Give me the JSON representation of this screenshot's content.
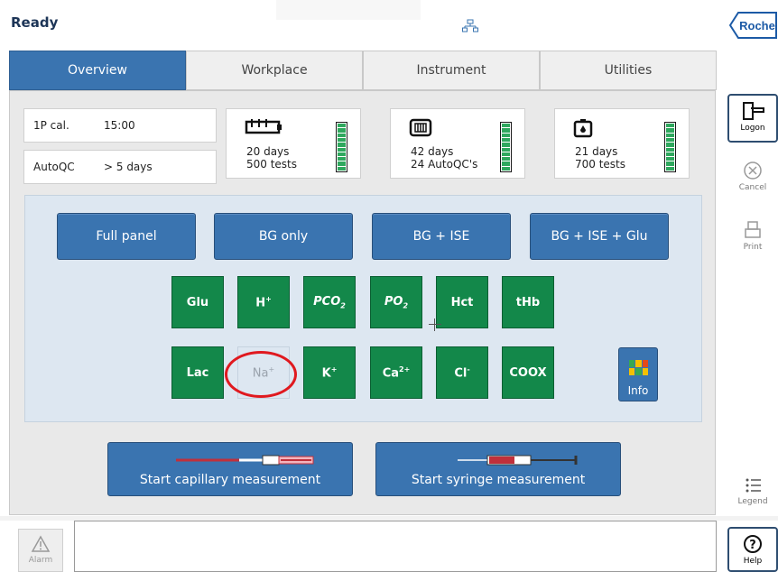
{
  "header": {
    "status": "Ready",
    "brand": "Roche"
  },
  "tabs": [
    {
      "label": "Overview",
      "active": true
    },
    {
      "label": "Workplace",
      "active": false
    },
    {
      "label": "Instrument",
      "active": false
    },
    {
      "label": "Utilities",
      "active": false
    }
  ],
  "calibration": {
    "cal_label": "1P cal.",
    "cal_value": "15:00",
    "qc_label": "AutoQC",
    "qc_value": "> 5 days"
  },
  "consumables": [
    {
      "icon": "sensor-cartridge-icon",
      "line1": "20 days",
      "line2": "500 tests",
      "level": 1.0
    },
    {
      "icon": "qc-cartridge-icon",
      "line1": "42 days",
      "line2": "24 AutoQC's",
      "level": 1.0
    },
    {
      "icon": "solution-pack-icon",
      "line1": "21 days",
      "line2": "700 tests",
      "level": 1.0
    }
  ],
  "panels": [
    "Full panel",
    "BG only",
    "BG + ISE",
    "BG + ISE + Glu"
  ],
  "parameters": {
    "glu": "Glu",
    "h_base": "H",
    "h_sup": "+",
    "pco2_base": "PCO",
    "pco2_sub": "2",
    "po2_base": "PO",
    "po2_sub": "2",
    "hct": "Hct",
    "thb": "tHb",
    "lac": "Lac",
    "na_base": "Na",
    "na_sup": "+",
    "k_base": "K",
    "k_sup": "+",
    "ca_base": "Ca",
    "ca_sup": "2+",
    "cl_base": "Cl",
    "cl_sup": "-",
    "coox": "COOX"
  },
  "info_label": "Info",
  "measurement": {
    "capillary": "Start capillary measurement",
    "syringe": "Start syringe measurement"
  },
  "sidebar": {
    "logon": "Logon",
    "cancel": "Cancel",
    "print": "Print",
    "legend": "Legend",
    "help": "Help"
  },
  "footer": {
    "alarm": "Alarm"
  },
  "colors": {
    "accent": "#3a74b0",
    "parameter_on": "#13884a",
    "highlight": "#e0191f"
  }
}
